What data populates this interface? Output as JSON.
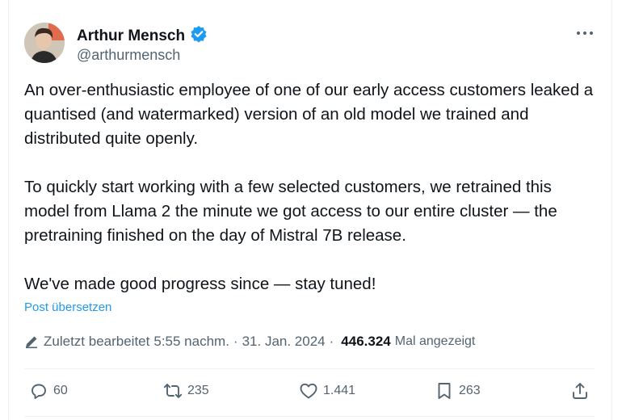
{
  "author": {
    "name": "Arthur Mensch",
    "handle": "@arthurmensch",
    "verified": true
  },
  "tweet": {
    "paragraphs": [
      "An over-enthusiastic employee of one of our early access customers leaked a quantised (and watermarked) version of an old model we trained and distributed quite openly.",
      "To quickly start working with a few selected customers, we retrained this model from Llama 2 the minute we got access to our entire cluster — the pretraining finished on the day of Mistral 7B release.",
      "We've made good progress since — stay tuned!"
    ],
    "translate_label": "Post übersetzen"
  },
  "meta": {
    "edited_label": "Zuletzt bearbeitet",
    "time": "5:55 nachm.",
    "separator1": "·",
    "date": "31. Jan. 2024",
    "separator2": "·",
    "views": "446.324",
    "views_label": "Mal angezeigt"
  },
  "actions": {
    "replies": "60",
    "reposts": "235",
    "likes": "1.441",
    "bookmarks": "263"
  },
  "colors": {
    "accent": "#1d9bf0",
    "secondary_text": "#536471",
    "primary_text": "#0f1419"
  }
}
